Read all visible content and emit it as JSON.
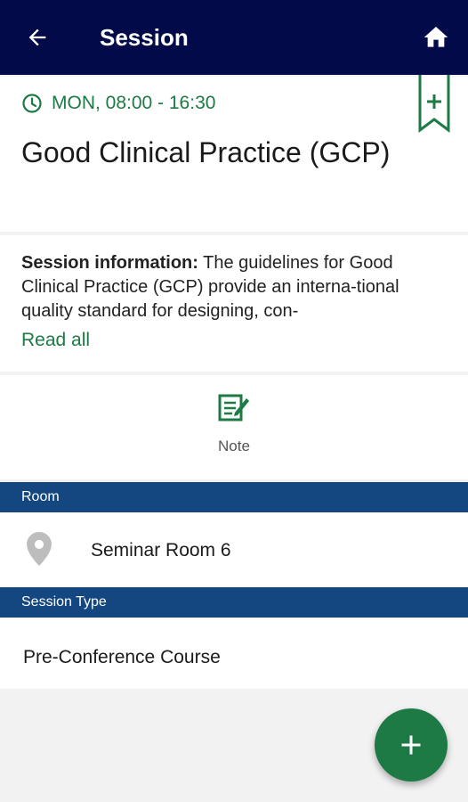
{
  "appbar": {
    "title": "Session",
    "back_icon": "arrow-left-icon",
    "home_icon": "home-icon",
    "background": "#020a4a"
  },
  "session": {
    "time": "MON, 08:00 - 16:30",
    "title": "Good Clinical Practice (GCP)",
    "bookmark_icon": "bookmark-add-icon"
  },
  "info": {
    "label": "Session information:",
    "text": " The guidelines for Good Clinical Practice (GCP) provide an interna-tional quality standard for designing, con-",
    "read_all": "Read all"
  },
  "note": {
    "label": "Note",
    "icon": "edit-note-icon"
  },
  "room": {
    "header": "Room",
    "value": "Seminar Room 6",
    "icon": "location-pin-icon"
  },
  "session_type": {
    "header": "Session Type",
    "value": "Pre-Conference Course"
  },
  "fab": {
    "icon": "plus-icon"
  },
  "colors": {
    "accent_green": "#1d7a45",
    "section_blue": "#14477f"
  }
}
